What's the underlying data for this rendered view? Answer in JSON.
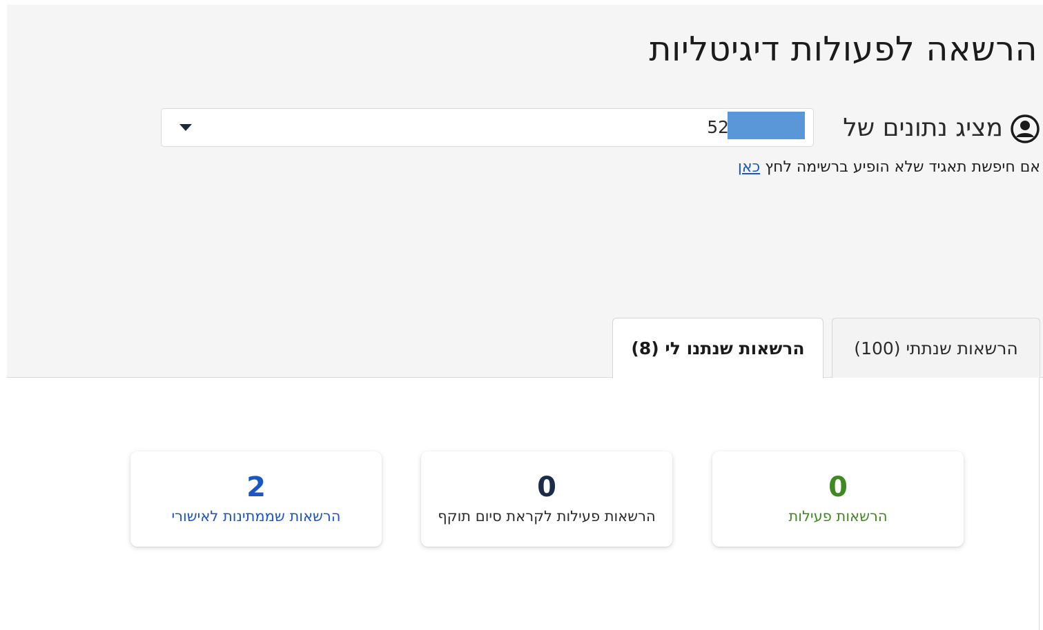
{
  "header": {
    "title": "הרשאה לפעולות דיגיטליות"
  },
  "account_selector": {
    "label": "מציג נתונים של",
    "value": "52",
    "icon": "user-circle-icon"
  },
  "help": {
    "text": "אם חיפשת תאגיד שלא הופיע ברשימה לחץ ",
    "link_label": "כאן"
  },
  "tabs": [
    {
      "label": "הרשאות שנתתי (100)",
      "selected": false
    },
    {
      "label": "הרשאות שנתנו לי (8)",
      "selected": true
    }
  ],
  "cards": {
    "active": {
      "value": "0",
      "label": "הרשאות פעילות",
      "color": "#3f8a20"
    },
    "expiring": {
      "value": "0",
      "label": "הרשאות פעילות לקראת סיום תוקף",
      "color": "#1a2c47"
    },
    "pending": {
      "value": "2",
      "label": "הרשאות שממתינות לאישורי",
      "color": "#1a56c6"
    }
  },
  "colors": {
    "link": "#1a56c6",
    "redaction": "#5a97d8",
    "header_background": "#f5f5f5"
  }
}
